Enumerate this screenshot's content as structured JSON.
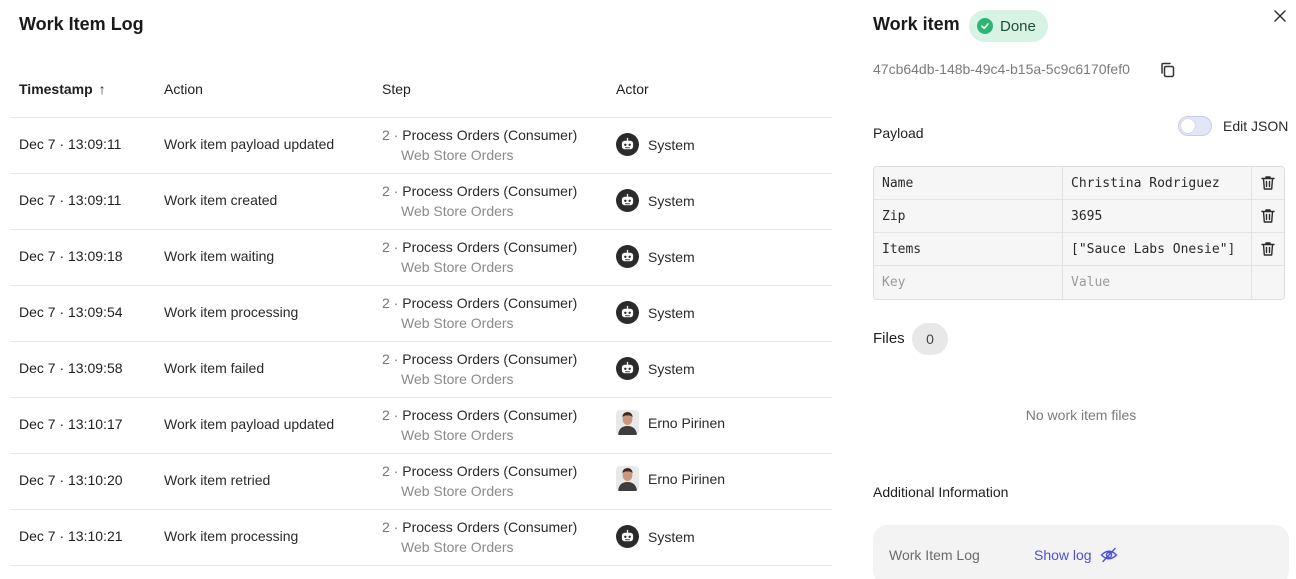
{
  "log": {
    "title": "Work Item Log",
    "columns": {
      "timestamp": "Timestamp",
      "sort_arrow": "↑",
      "action": "Action",
      "step": "Step",
      "actor": "Actor"
    },
    "rows": [
      {
        "timestamp": "Dec 7 · 13:09:11",
        "action": "Work item payload updated",
        "step_num": "2 · ",
        "step_name": "Process Orders (Consumer)",
        "step_sub": "Web Store Orders",
        "actor": "System"
      },
      {
        "timestamp": "Dec 7 · 13:09:11",
        "action": "Work item created",
        "step_num": "2 · ",
        "step_name": "Process Orders (Consumer)",
        "step_sub": "Web Store Orders",
        "actor": "System"
      },
      {
        "timestamp": "Dec 7 · 13:09:18",
        "action": "Work item waiting",
        "step_num": "2 · ",
        "step_name": "Process Orders (Consumer)",
        "step_sub": "Web Store Orders",
        "actor": "System"
      },
      {
        "timestamp": "Dec 7 · 13:09:54",
        "action": "Work item processing",
        "step_num": "2 · ",
        "step_name": "Process Orders (Consumer)",
        "step_sub": "Web Store Orders",
        "actor": "System"
      },
      {
        "timestamp": "Dec 7 · 13:09:58",
        "action": "Work item failed",
        "step_num": "2 · ",
        "step_name": "Process Orders (Consumer)",
        "step_sub": "Web Store Orders",
        "actor": "System"
      },
      {
        "timestamp": "Dec 7 · 13:10:17",
        "action": "Work item payload updated",
        "step_num": "2 · ",
        "step_name": "Process Orders (Consumer)",
        "step_sub": "Web Store Orders",
        "actor": "Erno Pirinen"
      },
      {
        "timestamp": "Dec 7 · 13:10:20",
        "action": "Work item retried",
        "step_num": "2 · ",
        "step_name": "Process Orders (Consumer)",
        "step_sub": "Web Store Orders",
        "actor": "Erno Pirinen"
      },
      {
        "timestamp": "Dec 7 · 13:10:21",
        "action": "Work item processing",
        "step_num": "2 · ",
        "step_name": "Process Orders (Consumer)",
        "step_sub": "Web Store Orders",
        "actor": "System"
      }
    ]
  },
  "work_item": {
    "title": "Work item",
    "status": "Done",
    "status_color": "#2bb673",
    "id": "47cb64db-148b-49c4-b15a-5c9c6170fef0",
    "payload_label": "Payload",
    "edit_json_label": "Edit JSON",
    "payload": [
      {
        "key": "Name",
        "value": "Christina Rodriguez"
      },
      {
        "key": "Zip",
        "value": "3695"
      },
      {
        "key": "Items",
        "value": "[\"Sauce Labs Onesie\"]"
      }
    ],
    "new_key_placeholder": "Key",
    "new_value_placeholder": "Value",
    "files_label": "Files",
    "files_count": "0",
    "no_files_text": "No work item files",
    "additional_label": "Additional Information",
    "log_card_label": "Work Item Log",
    "show_log_label": "Show log",
    "link_color": "#4b50d8"
  },
  "icons": {
    "close": "close-icon",
    "copy": "copy-icon",
    "check": "check-circle-icon",
    "trash": "trash-icon",
    "eye_off": "eye-off-icon",
    "robot": "robot-icon"
  }
}
